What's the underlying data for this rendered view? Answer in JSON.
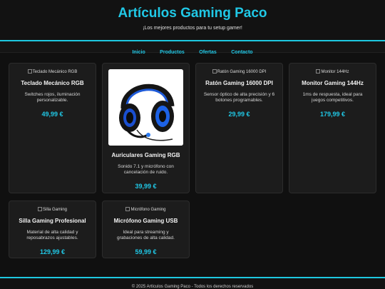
{
  "header": {
    "title": "Artículos Gaming Paco",
    "tagline": "¡Los mejores productos para tu setup gamer!"
  },
  "nav": [
    "Inicio",
    "Productos",
    "Ofertas",
    "Contacto"
  ],
  "products": [
    {
      "alt": "Teclado Mecánico RGB",
      "name": "Teclado Mecánico RGB",
      "desc": "Switches rojos, iluminación personalizable.",
      "price": "49,99 €"
    },
    {
      "alt": "Auriculares Gaming RGB",
      "name": "Auriculares Gaming RGB",
      "desc": "Sonido 7.1 y micrófono con cancelación de ruido.",
      "price": "39,99 €"
    },
    {
      "alt": "Ratón Gaming 16000 DPI",
      "name": "Ratón Gaming 16000 DPI",
      "desc": "Sensor óptico de alta precisión y 6 botones programables.",
      "price": "29,99 €"
    },
    {
      "alt": "Monitor 144Hz",
      "name": "Monitor Gaming 144Hz",
      "desc": "1ms de respuesta, ideal para juegos competitivos.",
      "price": "179,99 €"
    },
    {
      "alt": "Silla Gaming",
      "name": "Silla Gaming Profesional",
      "desc": "Material de alta calidad y reposabrazos ajustables.",
      "price": "129,99 €"
    },
    {
      "alt": "Micrófono Gaming",
      "name": "Micrófono Gaming USB",
      "desc": "Ideal para streaming y grabaciones de alta calidad.",
      "price": "59,99 €"
    }
  ],
  "footer": "© 2025 Artículos Gaming Paco - Todos los derechos reservados",
  "colors": {
    "accent": "#20c8e6",
    "background": "#101010",
    "card": "#1c1c1c"
  }
}
